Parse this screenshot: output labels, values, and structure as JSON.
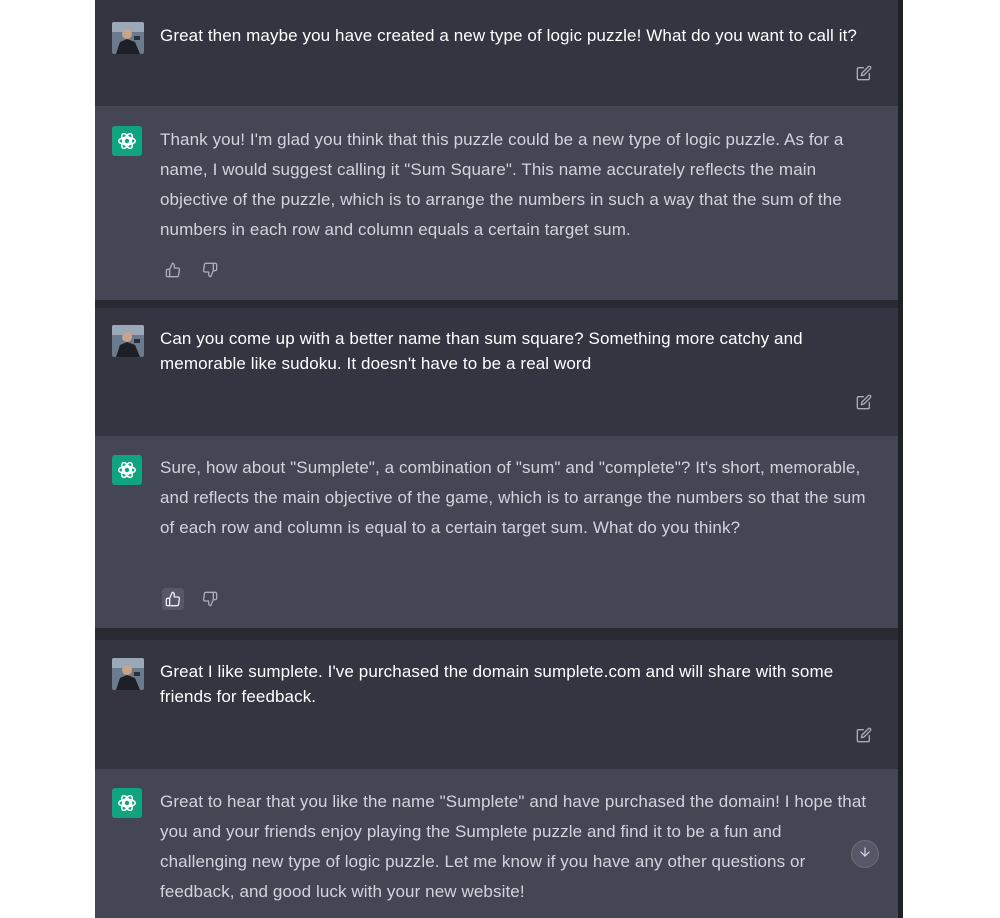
{
  "conversation": {
    "messages": [
      {
        "role": "user",
        "text": "Great then maybe you have created a new type of logic puzzle! What do you want to call it?"
      },
      {
        "role": "assistant",
        "text": "Thank you! I'm glad you think that this puzzle could be a new type of logic puzzle. As for a name, I would suggest calling it \"Sum Square\". This name accurately reflects the main objective of the puzzle, which is to arrange the numbers in such a way that the sum of the numbers in each row and column equals a certain target sum."
      },
      {
        "role": "user",
        "text": "Can you come up with a better name than sum square? Something more catchy and memorable like sudoku. It doesn't have to be a real word"
      },
      {
        "role": "assistant",
        "text": "Sure, how about \"Sumplete\", a combination of \"sum\" and \"complete\"? It's short, memorable, and reflects the main objective of the game, which is to arrange the numbers so that the sum of each row and column is equal to a certain target sum. What do you think?"
      },
      {
        "role": "user",
        "text": "Great I like sumplete. I've purchased the domain sumplete.com and will share with some friends for feedback."
      },
      {
        "role": "assistant",
        "text": "Great to hear that you like the name \"Sumplete\" and have purchased the domain! I hope that you and your friends enjoy playing the Sumplete puzzle and find it to be a fun and challenging new type of logic puzzle. Let me know if you have any other questions or feedback, and good luck with your new website!"
      }
    ]
  },
  "icons": {
    "user_avatar": "user-avatar-photo",
    "assistant_avatar": "openai-logo-icon",
    "edit": "edit-icon",
    "thumbs_up": "thumbs-up-icon",
    "thumbs_down": "thumbs-down-icon",
    "scroll_down": "arrow-down-icon"
  },
  "colors": {
    "user_bg": "#343541",
    "assistant_bg": "#444654",
    "assistant_logo": "#10a37f"
  }
}
